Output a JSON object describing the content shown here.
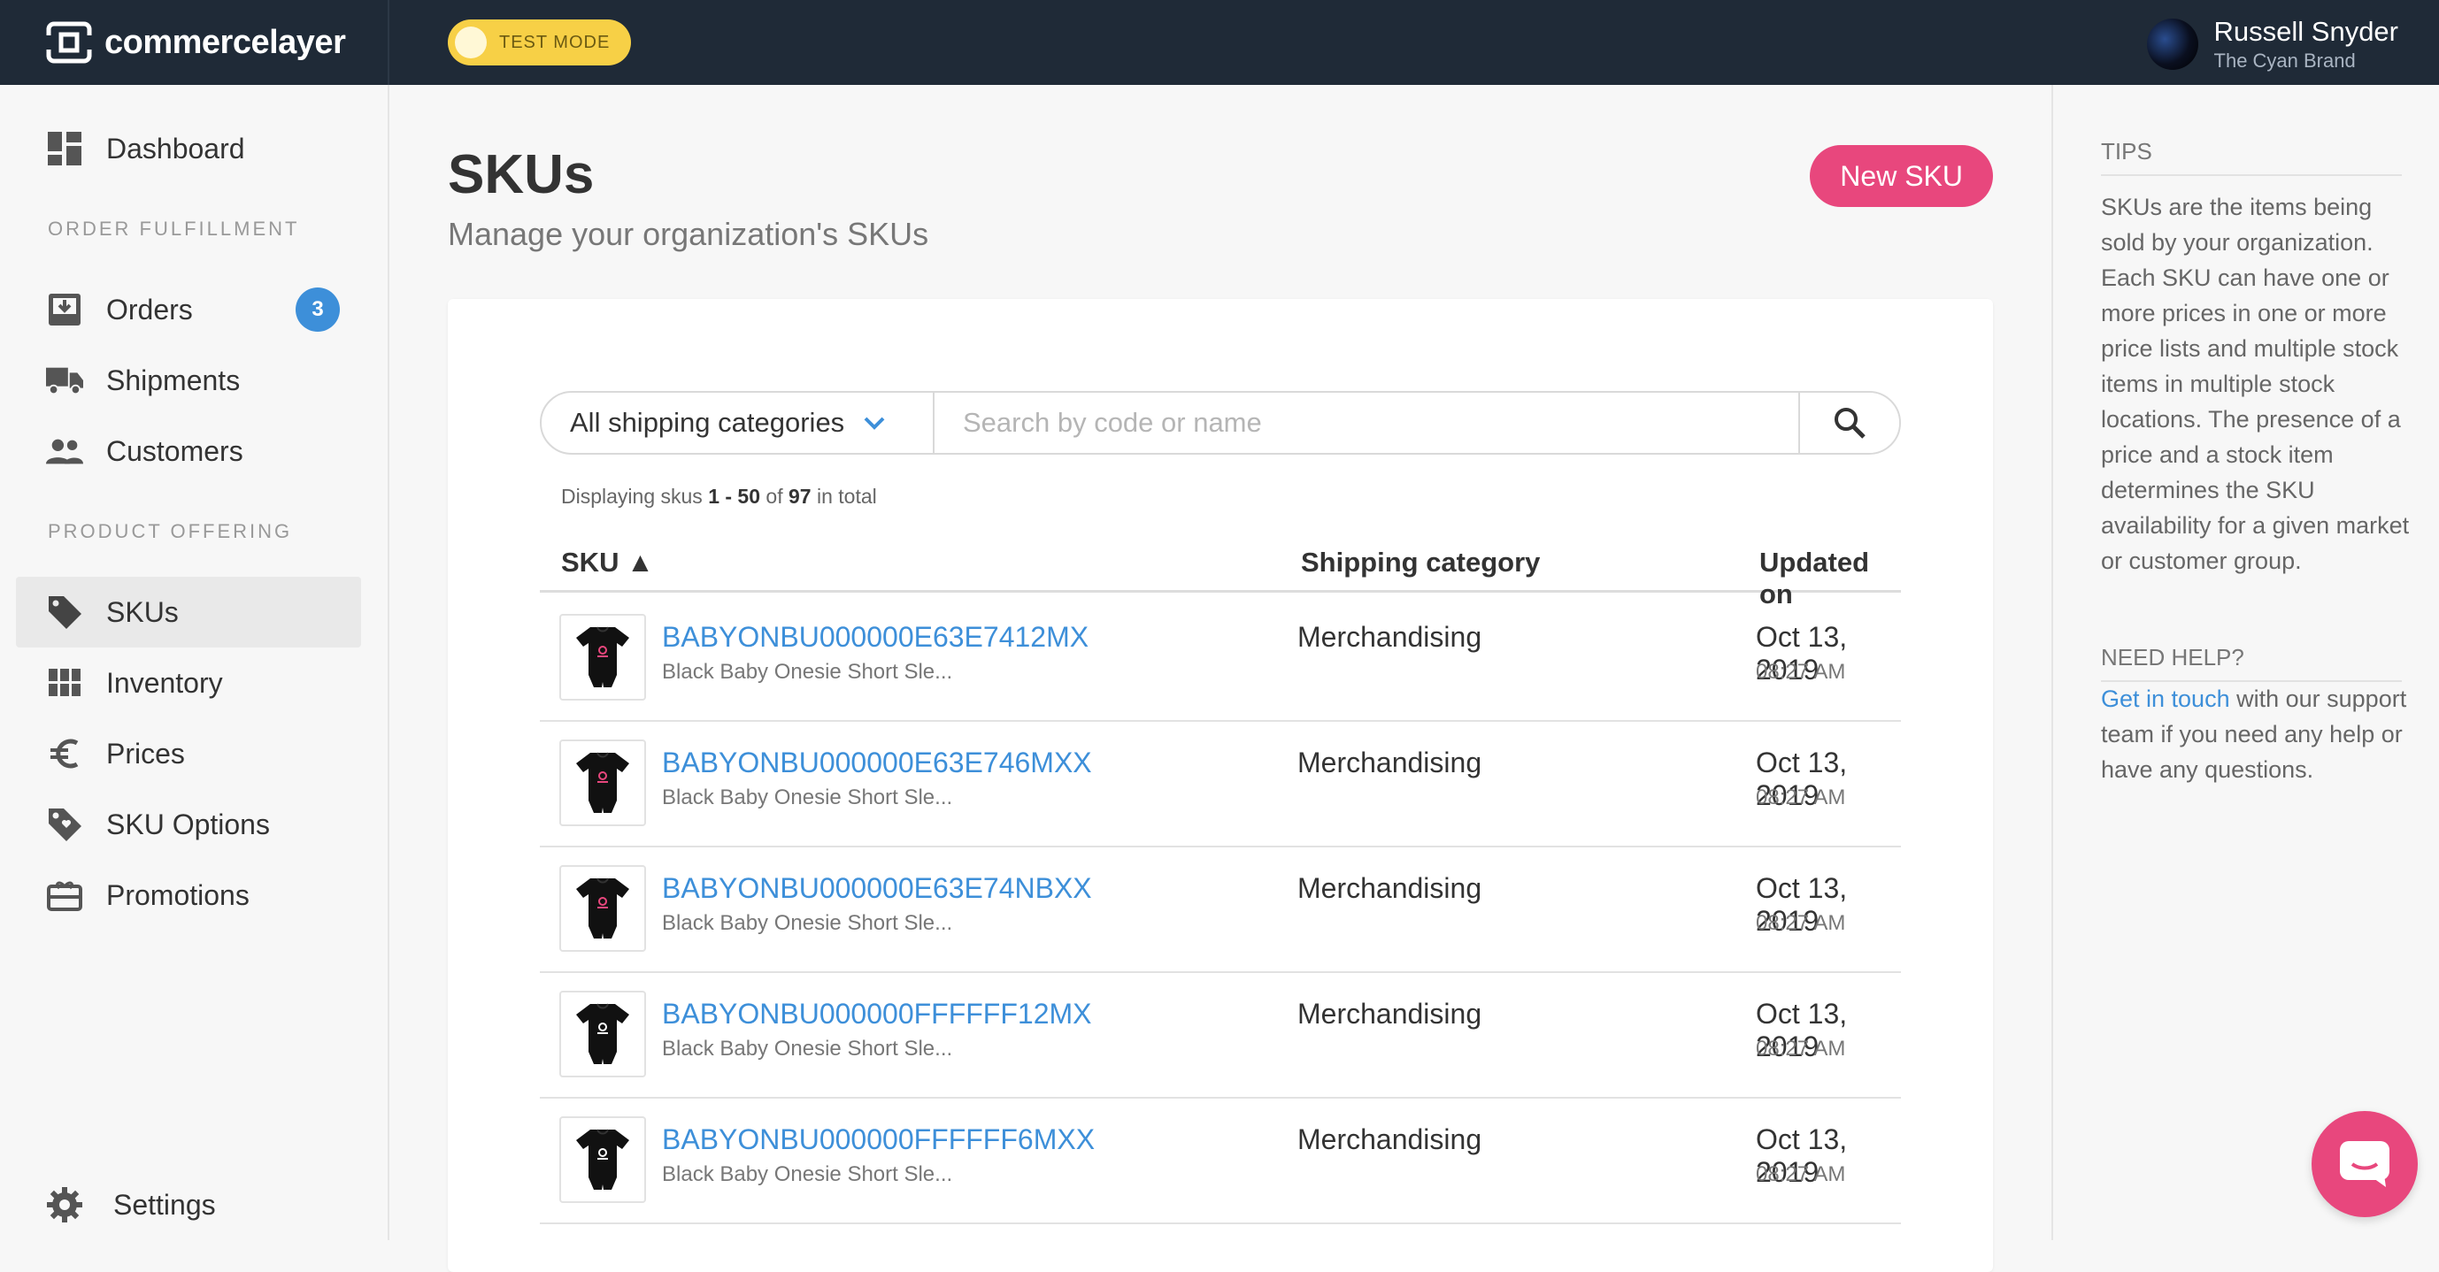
{
  "app": {
    "brand": "commercelayer",
    "test_mode_label": "TEST MODE"
  },
  "user": {
    "name": "Russell Snyder",
    "org": "The Cyan Brand"
  },
  "sidebar": {
    "dashboard": "Dashboard",
    "section_fulfillment": "ORDER FULFILLMENT",
    "orders": "Orders",
    "orders_badge": "3",
    "shipments": "Shipments",
    "customers": "Customers",
    "section_offering": "PRODUCT OFFERING",
    "skus": "SKUs",
    "inventory": "Inventory",
    "prices": "Prices",
    "sku_options": "SKU Options",
    "promotions": "Promotions",
    "settings": "Settings"
  },
  "main": {
    "title": "SKUs",
    "subtitle": "Manage your organization's SKUs",
    "new_button": "New SKU",
    "category_filter": "All shipping categories",
    "search_placeholder": "Search by code or name",
    "displaying_prefix": "Displaying skus",
    "displaying_range": "1 - 50",
    "displaying_of": "of",
    "displaying_total": "97",
    "displaying_suffix": "in total",
    "columns": {
      "sku": "SKU ▲",
      "shipping_category": "Shipping category",
      "updated_on": "Updated on"
    },
    "rows": [
      {
        "code": "BABYONBU000000E63E7412MX",
        "name": "Black Baby Onesie Short Sle...",
        "category": "Merchandising",
        "date": "Oct 13, 2019",
        "time": "08:27 AM",
        "print_color": "#e8477d"
      },
      {
        "code": "BABYONBU000000E63E746MXX",
        "name": "Black Baby Onesie Short Sle...",
        "category": "Merchandising",
        "date": "Oct 13, 2019",
        "time": "08:27 AM",
        "print_color": "#e8477d"
      },
      {
        "code": "BABYONBU000000E63E74NBXX",
        "name": "Black Baby Onesie Short Sle...",
        "category": "Merchandising",
        "date": "Oct 13, 2019",
        "time": "08:27 AM",
        "print_color": "#e8477d"
      },
      {
        "code": "BABYONBU000000FFFFFF12MX",
        "name": "Black Baby Onesie Short Sle...",
        "category": "Merchandising",
        "date": "Oct 13, 2019",
        "time": "08:27 AM",
        "print_color": "#ffffff"
      },
      {
        "code": "BABYONBU000000FFFFFF6MXX",
        "name": "Black Baby Onesie Short Sle...",
        "category": "Merchandising",
        "date": "Oct 13, 2019",
        "time": "08:27 AM",
        "print_color": "#ffffff"
      }
    ]
  },
  "tips": {
    "tips_heading": "TIPS",
    "tips_body": "SKUs are the items being sold by your organization. Each SKU can have one or more prices in one or more price lists and multiple stock items in multiple stock locations. The presence of a price and a stock item determines the SKU availability for a given market or customer group.",
    "help_heading": "NEED HELP?",
    "help_link": "Get in touch",
    "help_body": "with our support team if you need any help or have any questions."
  },
  "colors": {
    "topbar": "#1f2a37",
    "accent_pink": "#e8477d",
    "link_blue": "#3d8fd9",
    "test_mode": "#f7d046"
  },
  "icons": {
    "logo": "commercelayer-logo-icon",
    "dashboard": "dashboard-icon",
    "orders": "inbox-icon",
    "shipments": "truck-icon",
    "customers": "people-icon",
    "skus": "tag-icon",
    "inventory": "grid-icon",
    "prices": "euro-icon",
    "sku_options": "tag-heart-icon",
    "promotions": "gift-card-icon",
    "settings": "gear-icon",
    "search": "search-icon",
    "dropdown": "chevron-down-icon",
    "chat": "chat-icon"
  }
}
